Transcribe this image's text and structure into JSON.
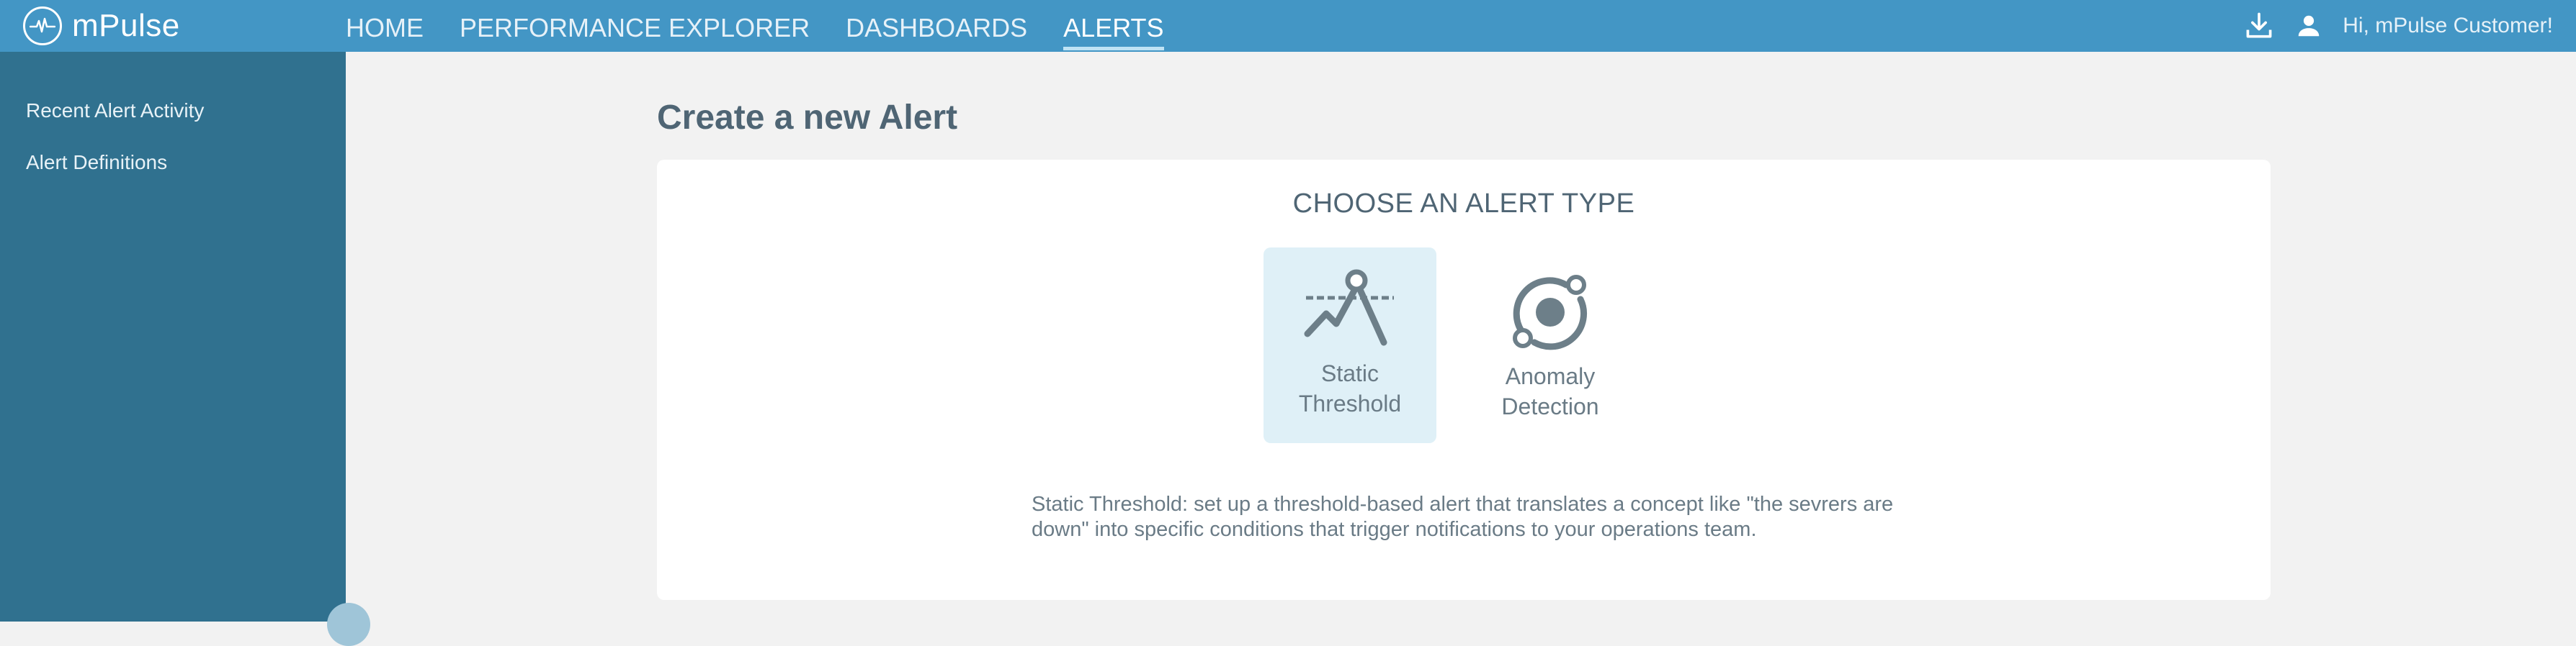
{
  "brand": {
    "name": "mPulse",
    "icon": "pulse-logo-icon"
  },
  "nav": {
    "items": [
      {
        "label": "HOME"
      },
      {
        "label": "PERFORMANCE EXPLORER"
      },
      {
        "label": "DASHBOARDS"
      },
      {
        "label": "ALERTS",
        "active": true
      }
    ]
  },
  "header": {
    "download_icon": "download-icon",
    "user_icon": "user-icon",
    "greeting": "Hi, mPulse Customer!"
  },
  "sidebar": {
    "items": [
      {
        "label": "Recent Alert Activity"
      },
      {
        "label": "Alert Definitions"
      }
    ]
  },
  "main": {
    "title": "Create a new Alert",
    "card": {
      "heading": "CHOOSE AN ALERT TYPE",
      "options": [
        {
          "line1": "Static",
          "line2": "Threshold",
          "icon": "static-threshold-icon",
          "selected": true
        },
        {
          "line1": "Anomaly",
          "line2": "Detection",
          "icon": "anomaly-detection-icon",
          "selected": false
        }
      ],
      "description": "Static Threshold: set up a threshold-based alert that translates a concept like \"the sevrers are down\" into specific conditions that trigger notifications to your operations team."
    }
  },
  "colors": {
    "topbar": "#4396c5",
    "sidebar": "#30718f",
    "background": "#f2f2f2",
    "selected_option": "#dff0f7",
    "text_dark": "#4f6574",
    "icon": "#6d7f89"
  }
}
